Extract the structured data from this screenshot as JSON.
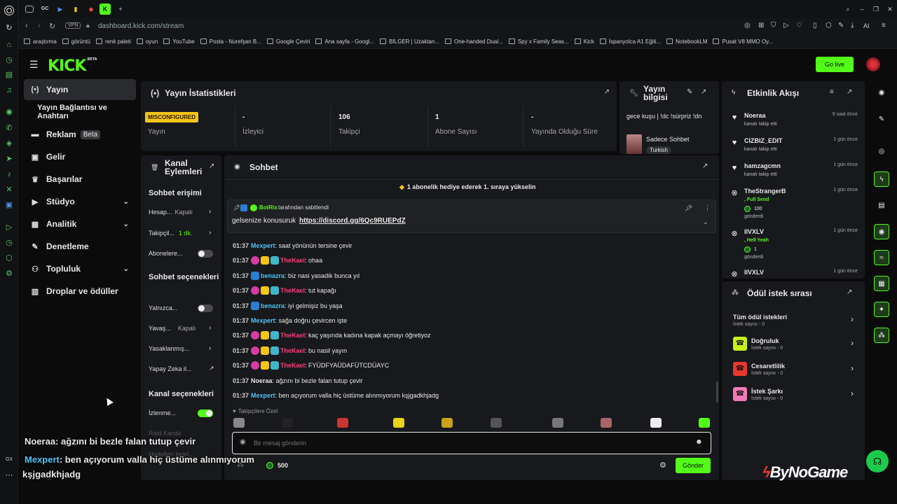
{
  "browser": {
    "tabs": [
      {
        "label": "GC"
      }
    ],
    "address": "dashboard.kick.com/stream",
    "vpn": "VPN",
    "ai": "AI",
    "bookmarks": [
      "araştırma",
      "görüntü",
      "renk paleti",
      "oyun",
      "YouTube",
      "Posta - Nurefşan B...",
      "Google Çeviri",
      "Ana sayfa - Googl...",
      "BİLGER | Uzaktan...",
      "One-handed Dual...",
      "Spy x Family Seas...",
      "Kick",
      "İspanyolca A1 Eğiti...",
      "NotebookLM",
      "Pusat V8 MMO Oy..."
    ],
    "sidebar_label": "GX"
  },
  "header": {
    "logo": "KICK",
    "beta": "BETA",
    "go_live": "Go live"
  },
  "nav": {
    "items": [
      {
        "label": "Yayın",
        "icon": "stream-icon"
      },
      {
        "label": "Yayın Bağlantısı ve Anahtarı"
      },
      {
        "label": "Reklam",
        "badge": "Beta"
      },
      {
        "label": "Gelir"
      },
      {
        "label": "Başarılar"
      },
      {
        "label": "Stüdyo"
      },
      {
        "label": "Analitik"
      },
      {
        "label": "Denetleme"
      },
      {
        "label": "Topluluk"
      },
      {
        "label": "Droplar ve ödüller"
      }
    ]
  },
  "stats": {
    "title": "Yayın İstatistikleri",
    "status_badge": "MISCONFIGURED",
    "items": [
      {
        "value": "",
        "label": "Yayın"
      },
      {
        "value": "-",
        "label": "İzleyici"
      },
      {
        "value": "106",
        "label": "Takipçi"
      },
      {
        "value": "1",
        "label": "Abone Sayısı"
      },
      {
        "value": "-",
        "label": "Yayında Olduğu Süre"
      }
    ]
  },
  "stream_info": {
    "title": "Yayın bilgisi",
    "stream_title": "gece kuşu | !dc !sürpriz !dn",
    "category": "Sadece Sohbet",
    "language": "Turkish"
  },
  "channel_actions": {
    "title": "Kanal Eylemleri",
    "chat_access": "Sohbet erişimi",
    "account": {
      "label": "Hesap...",
      "value": "Kapalı"
    },
    "followers": {
      "label": "Takipçil...",
      "value": "1 dk."
    },
    "subscribers": {
      "label": "Abonelere..."
    },
    "chat_options": "Sohbet seçenekleri",
    "only": {
      "label": "Yalnızca..."
    },
    "slow": {
      "label": "Yavaş...",
      "value": "Kapalı"
    },
    "banned": {
      "label": "Yasaklanmış..."
    },
    "ai": {
      "label": "Yapay Zeka il..."
    },
    "channel_options": "Kanal seçenekleri",
    "watch": {
      "label": "İzlenme..."
    },
    "raid": "Raid Kanalı",
    "targets": "Hedefleri belirl..."
  },
  "chat": {
    "title": "Sohbet",
    "gift_banner": "1 abonelik hediye ederek 1. sıraya yükselin",
    "pinned_by": "BotRix",
    "pinned_suffix": "tarafından sabitlendi",
    "pinned_text": "gelsenize konusuruk",
    "pinned_link": "https://discord.gg/6Qc9RUEPdZ",
    "messages": [
      {
        "time": "01:37",
        "user": "Mexpert",
        "text": ": saat yönünün tersine çevir",
        "badges": 0,
        "color": "#4fc3f7"
      },
      {
        "time": "01:37",
        "user": "TheKael",
        "text": ": ohaa",
        "badges": 3,
        "color": "#ff3c7a"
      },
      {
        "time": "01:37",
        "user": "benazra",
        "text": ": biz nasi yasadik bunca yıl",
        "badges": 1,
        "color": "#4fc3f7"
      },
      {
        "time": "01:37",
        "user": "TheKael",
        "text": ": tut kapağı",
        "badges": 3,
        "color": "#ff3c7a"
      },
      {
        "time": "01:37",
        "user": "benazra",
        "text": ": iyi gelmişiz bu yaşa",
        "badges": 1,
        "color": "#4fc3f7"
      },
      {
        "time": "01:37",
        "user": "Mexpert",
        "text": ": sağa doğru çevircen işte",
        "badges": 0,
        "color": "#4fc3f7"
      },
      {
        "time": "01:37",
        "user": "TheKael",
        "text": ": kaç yaşında kadına kapak açmayı öğretiyoz",
        "badges": 3,
        "color": "#ff3c7a"
      },
      {
        "time": "01:37",
        "user": "TheKael",
        "text": ": bu nasil yayın",
        "badges": 3,
        "color": "#ff3c7a"
      },
      {
        "time": "01:37",
        "user": "TheKael",
        "text": ": FYÜDFYAÜDAFÜTCDÜAYC",
        "badges": 3,
        "color": "#ff3c7a"
      },
      {
        "time": "01:37",
        "user": "Noeraa",
        "text": ": ağzını bi bezle falan tutup çevir",
        "badges": 0,
        "color": "#e8e8e8"
      },
      {
        "time": "01:37",
        "user": "Mexpert",
        "text": ": ben açıyorum valla hiç üstüme alınmıyorum kşjgadkhjadg",
        "badges": 0,
        "color": "#4fc3f7"
      }
    ],
    "followers_only": "Takipçilere Özel",
    "input_placeholder": "Bir mesaj gönderin",
    "points": "500",
    "send": "Gönder"
  },
  "activity": {
    "title": "Etkinlik Akışı",
    "events": [
      {
        "name": "Noeraa",
        "sub": "kanalı takip etti",
        "time": "9 saat önce",
        "icon": "heart-icon"
      },
      {
        "name": "CIZBIZ_EDIT",
        "sub": "kanalı takip etti",
        "time": "1 gün önce",
        "icon": "heart-icon"
      },
      {
        "name": "hamzagcmn",
        "sub": "kanalı takip etti",
        "time": "1 gün önce",
        "icon": "heart-icon"
      },
      {
        "name": "TheStrangerB",
        "sub": ", Full Send",
        "amount": "100",
        "sent": "gönderdi",
        "time": "1 gün önce",
        "icon": "kick-icon"
      },
      {
        "name": "IIVXLV",
        "sub": ", Hell Yeah",
        "amount": "1",
        "sent": "gönderdi",
        "time": "1 gün önce",
        "icon": "kick-icon"
      },
      {
        "name": "IIVXLV",
        "sub": "",
        "time": "1 gün önce",
        "icon": "kick-icon"
      }
    ]
  },
  "rewards": {
    "title": "Ödül istek sırası",
    "items": [
      {
        "name": "Tüm ödül istekleri",
        "sub": "İstek sayısı - 0",
        "color": ""
      },
      {
        "name": "Doğruluk",
        "sub": "İstek sayısı - 0",
        "color": "#c7f01a"
      },
      {
        "name": "Cesaretlilik",
        "sub": "İstek sayısı - 0",
        "color": "#e8382e"
      },
      {
        "name": "İstek Şarkı",
        "sub": "İstek sayısı - 0",
        "color": "#f07ab6"
      }
    ]
  },
  "overlay": {
    "line1_user": "Noeraa",
    "line1_text": ": ağzını bi bezle falan tutup çevir",
    "line2_user": "Mexpert",
    "line2_text": ": ben açıyorum valla hiç üstüme alınmıyorum",
    "line3_text": "kşjgadkhjadg",
    "watermark": "ByNoGame"
  }
}
